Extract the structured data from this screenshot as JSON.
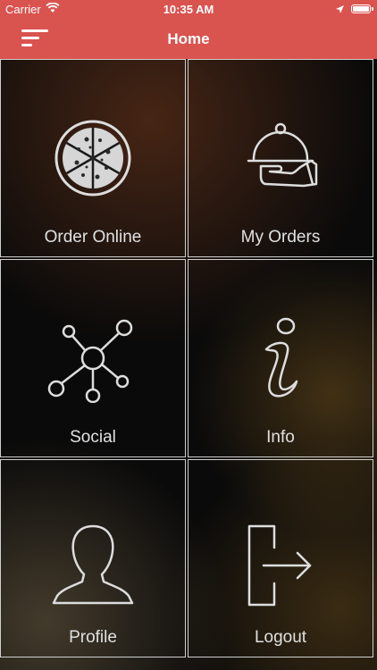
{
  "status_bar": {
    "carrier": "Carrier",
    "time": "10:35 AM"
  },
  "navbar": {
    "title": "Home",
    "menu_icon": "menu-lines-icon"
  },
  "tiles": [
    {
      "label": "Order Online",
      "icon": "pizza-icon"
    },
    {
      "label": "My Orders",
      "icon": "cloche-icon"
    },
    {
      "label": "Social",
      "icon": "network-icon"
    },
    {
      "label": "Info",
      "icon": "info-icon"
    },
    {
      "label": "Profile",
      "icon": "user-profile-icon"
    },
    {
      "label": "Logout",
      "icon": "logout-icon"
    }
  ],
  "colors": {
    "accent": "#d9534f",
    "tile_border": "#cfcfcf",
    "label": "#e0e0e0"
  }
}
